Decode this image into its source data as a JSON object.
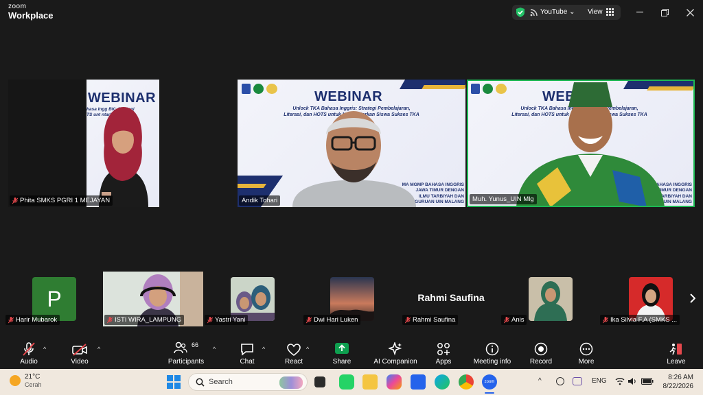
{
  "app": {
    "brand_top": "zoom",
    "brand_bottom": "Workplace"
  },
  "header": {
    "stream_label": "YouTube",
    "view_label": "View"
  },
  "tiles": [
    {
      "name": "Phita SMKS PGRI 1 MEJAYAN",
      "muted": true
    },
    {
      "name": "Andik Tohari",
      "muted": false
    },
    {
      "name": "Muh. Yunus_UIN Mlg",
      "muted": false,
      "active_speaker": true
    }
  ],
  "slide": {
    "title": "WEBINAR",
    "line1": "Unlock TKA Bahasa Inggris: Strategi Pembelajaran,",
    "line2": "Literasi, dan HOTS untuk Mengantarkan Siswa Sukses TKA",
    "corner1": "MA MGMP BAHASA INGGRIS",
    "corner2": "JAWA TIMUR DENGAN",
    "corner3": "ILMU TARBIYAH DAN",
    "corner4": "GURUAN UIN MALANG",
    "crop_a": "WEBINAR",
    "crop_b": "hasa Ingg",
    "crop_c": "BK: Strategi",
    "crop_d": "TS unt",
    "crop_e": "ntarkan S",
    "crop_f": "Unlock TKA Bahasa In",
    "crop_g": "trategi Pembelajaran,",
    "crop_h": "Literasi, dan HOTS unt",
    "crop_i": "Siswa Sukses TKA",
    "crop_j": "Unlock TKA Bahasa",
    "crop_k": ": Strategi Pembelajaran,",
    "crop_l": "Literasi, dan HO",
    "crop_m": "arkan Siswa Sukses TKA",
    "crop_n": "MA MGMP BAHASA INGGRIS",
    "crop_o": "JAWA TIMUR DENGAN",
    "crop_p": "MU TARBIYAH DAN",
    "crop_q": "UAN UIN MALANG",
    "crop_r": "BAHASA INGGRIS",
    "crop_s": "TIMUR DENGAN",
    "crop_t": "TARBIYAH DAN",
    "crop_u": "UIN MALANG"
  },
  "gallery": [
    {
      "name": "Harir Mubarok",
      "initial": "P",
      "avatar_color": "#2f7d32"
    },
    {
      "name": "ISTI WIRA_LAMPUNG"
    },
    {
      "name": "Yastri Yani"
    },
    {
      "name": "Dwi Hari Luken"
    },
    {
      "name": "Rahmi Saufina",
      "display_text": "Rahmi Saufina"
    },
    {
      "name": "Anis"
    },
    {
      "name": "Ika Silvia F.A (SMKS ..."
    }
  ],
  "toolbar": {
    "audio": "Audio",
    "video": "Video",
    "participants": "Participants",
    "participants_count": "66",
    "chat": "Chat",
    "react": "React",
    "share": "Share",
    "ai": "AI Companion",
    "apps": "Apps",
    "meeting_info": "Meeting info",
    "record": "Record",
    "more": "More",
    "leave": "Leave"
  },
  "taskbar": {
    "weather_temp": "21°C",
    "weather_desc": "Cerah",
    "search_placeholder": "Search",
    "lang": "ENG",
    "time": "8:26 AM",
    "date": "8/22/2026"
  },
  "colors": {
    "accent_green": "#1db954",
    "leave_red": "#e5484d",
    "share_green": "#0e9f4f"
  }
}
